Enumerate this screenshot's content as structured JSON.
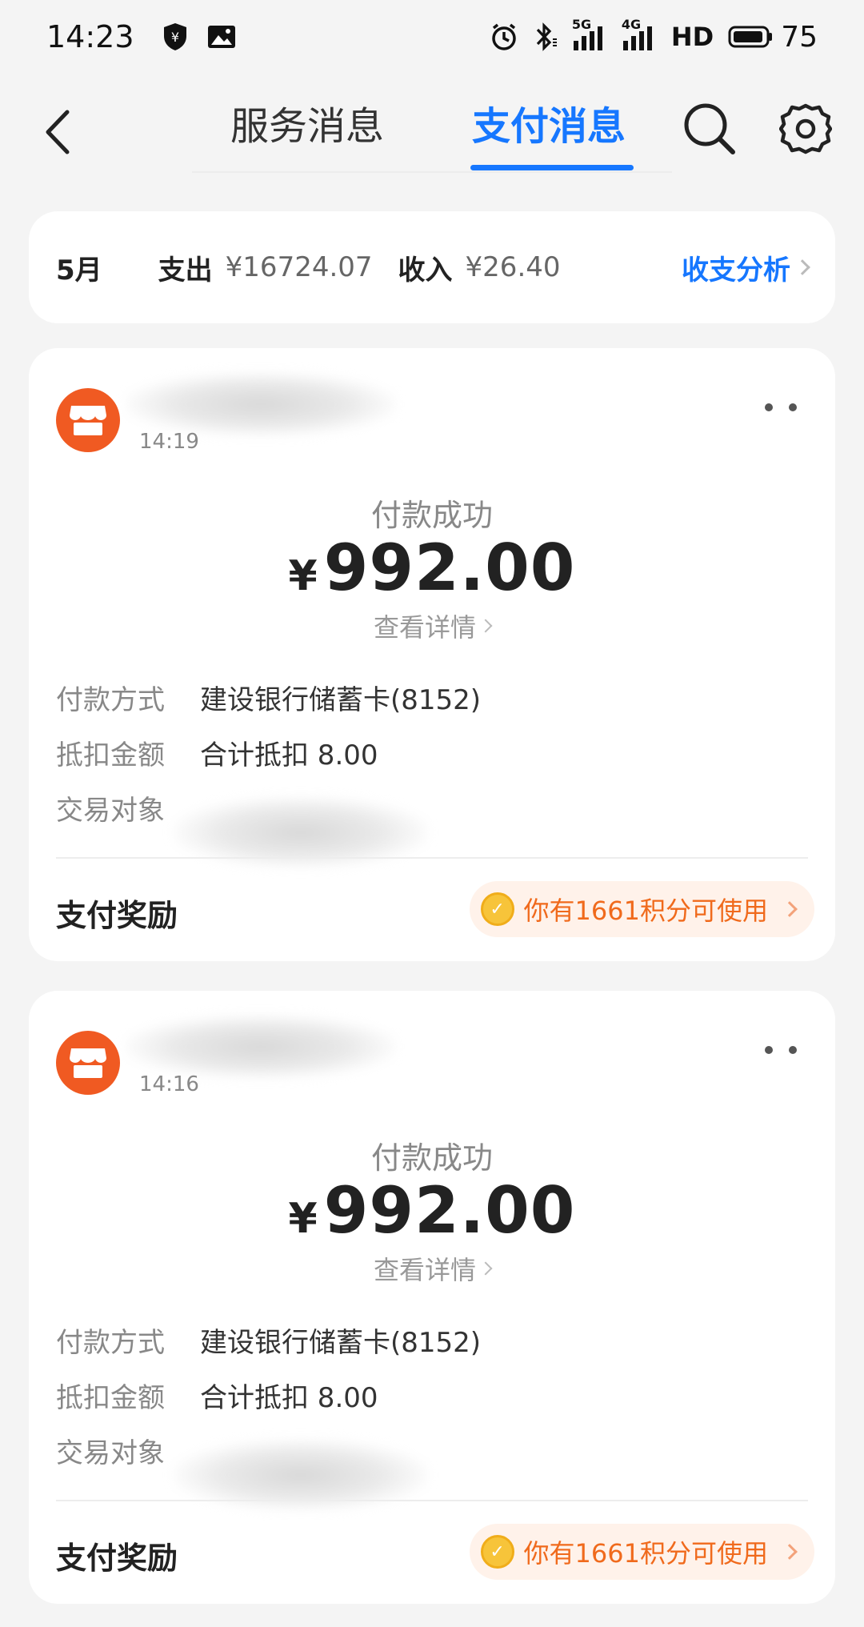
{
  "status_bar": {
    "time": "14:23",
    "network_label_1": "5G",
    "network_label_2": "4G",
    "hd_label": "HD",
    "battery_level": "75",
    "icons": [
      "shield-yuan-icon",
      "image-icon",
      "alarm-icon",
      "bluetooth-icon",
      "signal-icon",
      "battery-icon"
    ]
  },
  "header": {
    "tabs": [
      {
        "label": "服务消息",
        "active": false
      },
      {
        "label": "支付消息",
        "active": true
      }
    ],
    "accent_color": "#1677ff"
  },
  "summary": {
    "month": "5月",
    "expense_label": "支出",
    "expense_value": "¥16724.07",
    "income_label": "收入",
    "income_value": "¥26.40",
    "analysis_label": "收支分析"
  },
  "transactions": [
    {
      "time": "14:19",
      "status": "付款成功",
      "currency": "¥",
      "amount": "992.00",
      "detail_link": "查看详情",
      "rows": [
        {
          "key": "付款方式",
          "value": "建设银行储蓄卡(8152)"
        },
        {
          "key": "抵扣金额",
          "value": "合计抵扣 8.00"
        },
        {
          "key": "交易对象",
          "value": ""
        }
      ],
      "reward_label": "支付奖励",
      "reward_text": "你有1661积分可使用"
    },
    {
      "time": "14:16",
      "status": "付款成功",
      "currency": "¥",
      "amount": "992.00",
      "detail_link": "查看详情",
      "rows": [
        {
          "key": "付款方式",
          "value": "建设银行储蓄卡(8152)"
        },
        {
          "key": "抵扣金额",
          "value": "合计抵扣 8.00"
        },
        {
          "key": "交易对象",
          "value": ""
        }
      ],
      "reward_label": "支付奖励",
      "reward_text": "你有1661积分可使用"
    }
  ]
}
